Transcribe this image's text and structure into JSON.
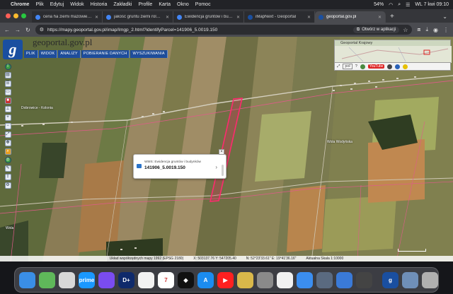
{
  "menubar": {
    "apple": "",
    "app": "Chrome",
    "items": [
      "Plik",
      "Edytuj",
      "Widok",
      "Historia",
      "Zakładki",
      "Profile",
      "Karta",
      "Okno",
      "Pomoc"
    ],
    "battery": "54%",
    "clock": "WL 7 kwi 09:10"
  },
  "tabs": [
    {
      "label": "cena ha ziemi mazowieckie -",
      "favicon_color": "#4285f4",
      "active": false
    },
    {
      "label": "jakość gruntu ziemi rolnej - G",
      "favicon_color": "#4285f4",
      "active": false
    },
    {
      "label": "Ewidencja gruntów i budynkó",
      "favicon_color": "#4285f4",
      "active": false
    },
    {
      "label": "iMapNext - Geoportal",
      "favicon_color": "#1a4fa0",
      "active": false
    },
    {
      "label": "geoportal.gov.pl",
      "favicon_color": "#1a4fa0",
      "active": true
    }
  ],
  "address": {
    "url": "https://mapy.geoportal.gov.pl/imap/Imgp_2.html?identifyParcel=141906_5.0019.150",
    "open_in_app": "Otwórz w aplikacji"
  },
  "geoportal": {
    "logo_letter": "g",
    "site_title": "geoportal.gov.pl",
    "menu": [
      "PLIK",
      "WIDOK",
      "ANALIZY",
      "POBIERANIE DANYCH",
      "WYSZUKIWANIA"
    ]
  },
  "inset": {
    "label": "Geoportal Krajowy",
    "select_value": "pol",
    "youtube_label": "YouTube"
  },
  "popup": {
    "layer": "WMS: Ewidencja gruntów i budynków",
    "parcel": "141906_5.0019.150"
  },
  "map_labels": {
    "left_place": "Dobrowice - Kolonia",
    "right_place": "Wola Wodyńska",
    "bottom_left": "Wola"
  },
  "status": {
    "system": "Układ współrzędnych mapy 1992 (EPSG 2180)",
    "xy": "X: 503137.76  Y: 547205.40",
    "latlon": "N: 52°23'33.61\"  E: 19°41'36.16\"",
    "scale": "Aktualna Skala 1:10000"
  },
  "dock": [
    {
      "name": "finder",
      "color": "#3a8ee6",
      "label": ""
    },
    {
      "name": "maps",
      "color": "#5fb85a",
      "label": ""
    },
    {
      "name": "launchpad",
      "color": "#d8d8d8",
      "label": ""
    },
    {
      "name": "prime-video",
      "color": "#1a98ff",
      "label": "prime"
    },
    {
      "name": "messenger",
      "color": "#7a4cf0",
      "label": ""
    },
    {
      "name": "disney",
      "color": "#0f2a6b",
      "label": "D+"
    },
    {
      "name": "photos",
      "color": "#f2f2f2",
      "label": ""
    },
    {
      "name": "calendar",
      "color": "#ffffff",
      "label": "7"
    },
    {
      "name": "tidal",
      "color": "#111111",
      "label": "◆"
    },
    {
      "name": "app-store",
      "color": "#1b8cf0",
      "label": "A"
    },
    {
      "name": "youtube",
      "color": "#ff2020",
      "label": "▶"
    },
    {
      "name": "coins",
      "color": "#d9b84a",
      "label": ""
    },
    {
      "name": "system-settings",
      "color": "#8a8a8a",
      "label": ""
    },
    {
      "name": "chrome",
      "color": "#f1f1f1",
      "label": ""
    },
    {
      "name": "mail",
      "color": "#3b8ef0",
      "label": ""
    },
    {
      "name": "preview",
      "color": "#5a6a80",
      "label": ""
    },
    {
      "name": "safari-blue",
      "color": "#3a7ad8",
      "label": ""
    },
    {
      "name": "calculator",
      "color": "#444444",
      "label": ""
    },
    {
      "name": "geoportal",
      "color": "#1a4fa0",
      "label": "g"
    },
    {
      "name": "downloads",
      "color": "#6f8fb8",
      "label": ""
    },
    {
      "name": "trash",
      "color": "#b0b0b0",
      "label": ""
    }
  ]
}
